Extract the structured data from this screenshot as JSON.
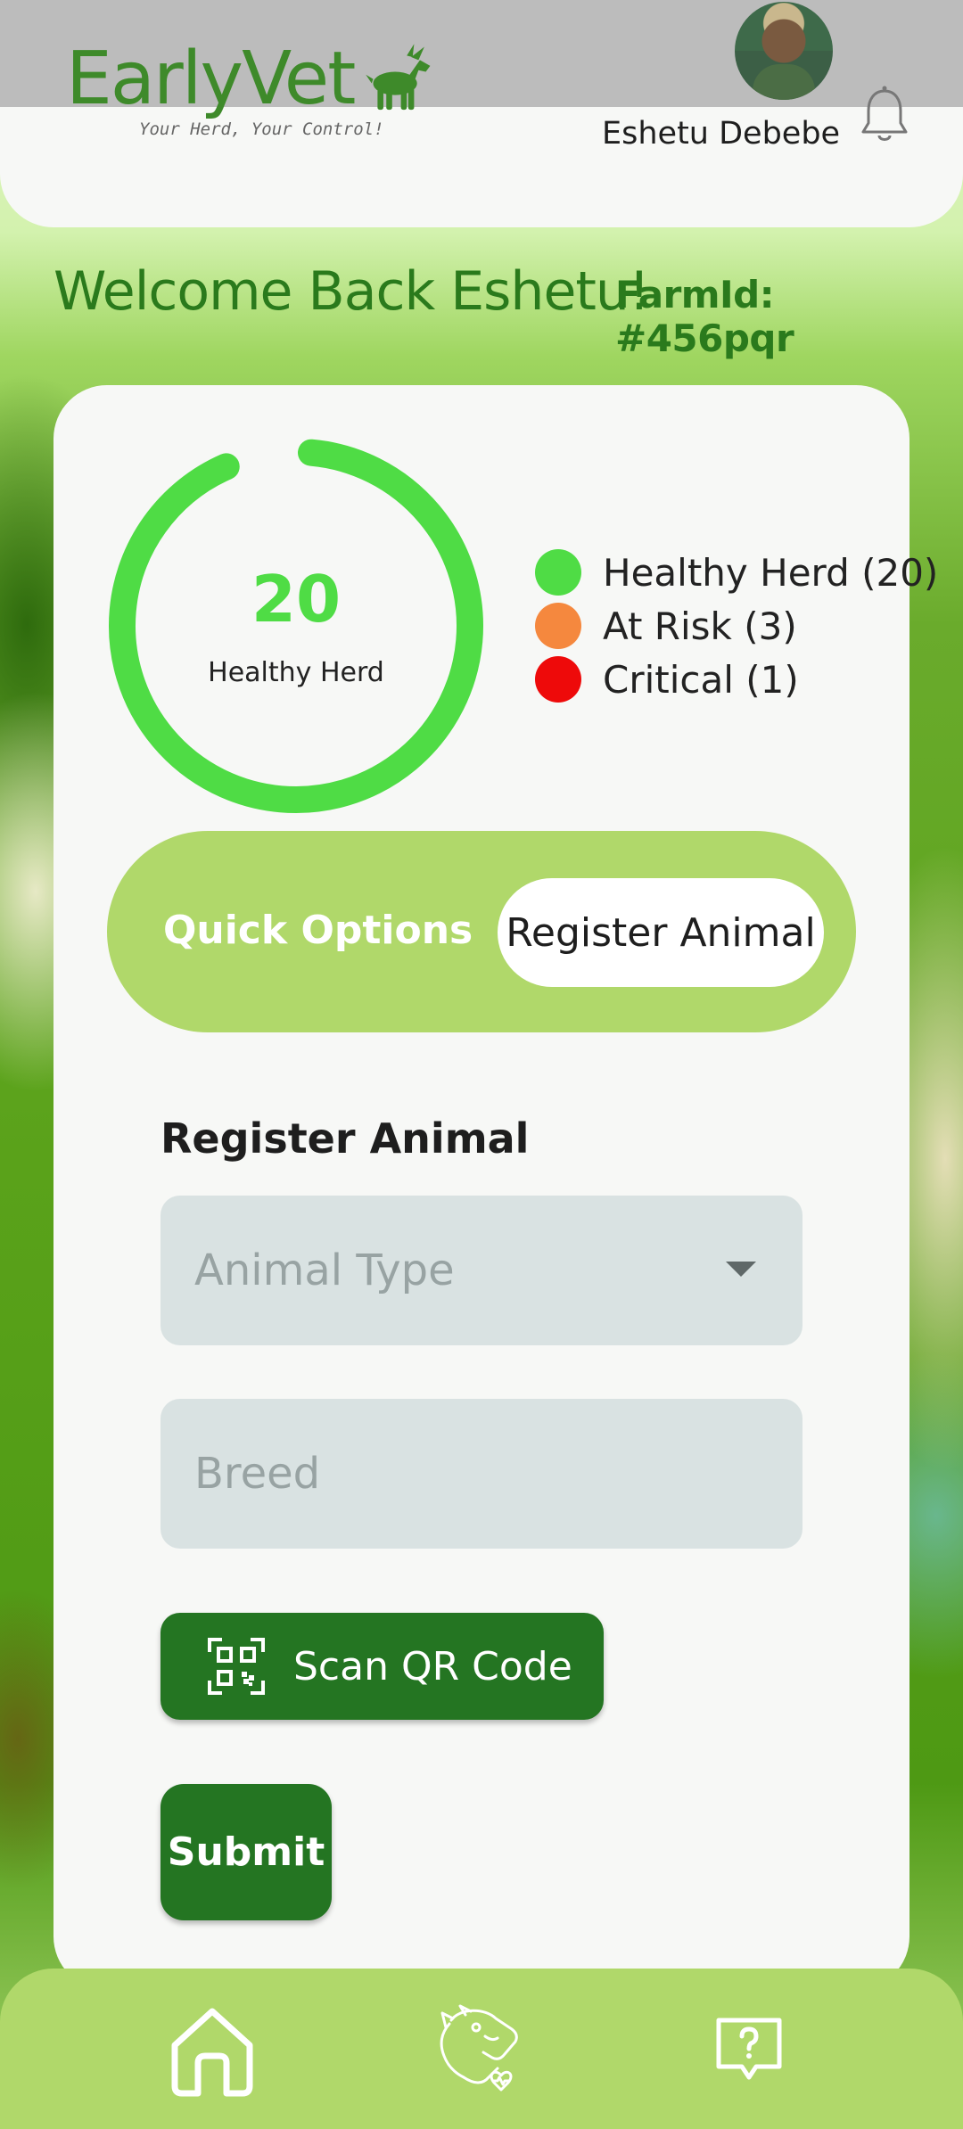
{
  "app": {
    "title": "EarlyVet",
    "tagline": "Your Herd, Your Control!",
    "logo_icon": "goat-icon"
  },
  "user": {
    "name": "Eshetu Debebe",
    "avatar_icon": "user-avatar",
    "notifications_icon": "bell-icon"
  },
  "welcome": {
    "text": "Welcome Back Eshetu!",
    "farm_id": "FarmId: #456pqr"
  },
  "herd_summary": {
    "donut_value": "20",
    "donut_label": "Healthy Herd",
    "fill_fraction": 0.92,
    "legend": [
      {
        "label": "Healthy Herd (20)",
        "color": "#4fdc45"
      },
      {
        "label": "At Risk (3)",
        "color": "#f5883e"
      },
      {
        "label": "Critical (1)",
        "color": "#ee0a0a"
      }
    ]
  },
  "quick_options": {
    "title": "Quick Options",
    "button_label": "Register Animal"
  },
  "register_form": {
    "title": "Register Animal",
    "animal_type_placeholder": "Animal Type",
    "breed_placeholder": "Breed",
    "scan_button_label": "Scan QR Code",
    "scan_icon": "qr-code-icon",
    "submit_label": "Submit"
  },
  "bottom_nav": {
    "items": [
      {
        "name": "home",
        "icon": "home-icon"
      },
      {
        "name": "vet",
        "icon": "animal-health-icon"
      },
      {
        "name": "help",
        "icon": "help-icon"
      }
    ]
  },
  "colors": {
    "brand_green": "#3e8a2a",
    "dark_green": "#247522",
    "accent_light_green": "#b0d86a",
    "healthy": "#4fdc45",
    "at_risk": "#f5883e",
    "critical": "#ee0a0a"
  }
}
